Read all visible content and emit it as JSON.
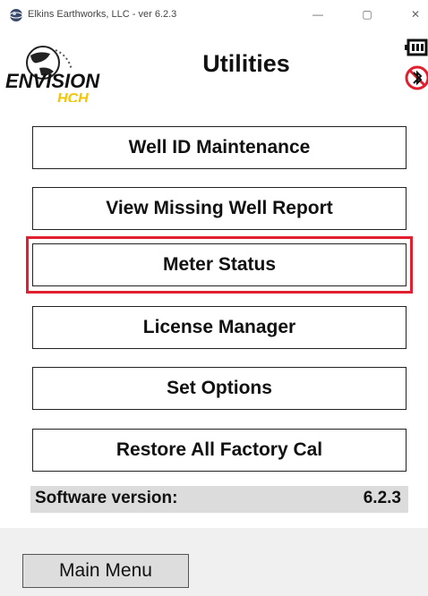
{
  "window": {
    "title": "Elkins Earthworks, LLC - ver 6.2.3",
    "minimize_glyph": "—",
    "maximize_glyph": "▢",
    "close_glyph": "✕"
  },
  "header": {
    "logo_text": "ENVISION",
    "logo_subtext": "HCH",
    "title": "Utilities",
    "icons": [
      "battery-icon",
      "bluetooth-disabled-icon"
    ]
  },
  "menu": {
    "buttons": [
      {
        "label": "Well ID Maintenance"
      },
      {
        "label": "View Missing Well Report"
      },
      {
        "label": "Meter Status",
        "highlighted": true
      },
      {
        "label": "License Manager"
      },
      {
        "label": "Set Options"
      },
      {
        "label": "Restore All Factory Cal"
      }
    ]
  },
  "version": {
    "label": "Software version:",
    "value": "6.2.3"
  },
  "footer": {
    "main_menu_label": "Main Menu"
  },
  "colors": {
    "highlight": "#e0202e",
    "logo_green": "#1db34a",
    "logo_yellow": "#f5c400"
  }
}
